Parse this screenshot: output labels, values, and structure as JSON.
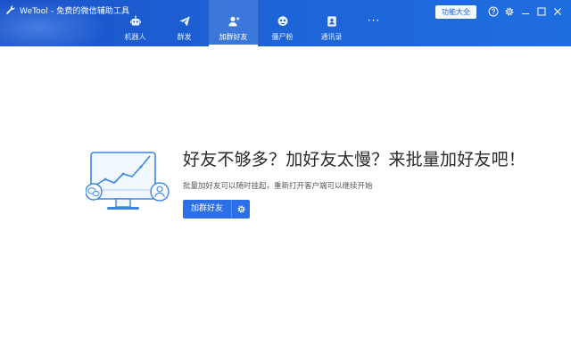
{
  "app": {
    "title": "WeTool - 免费的微信辅助工具",
    "logo_icon": "wrench-icon"
  },
  "tabs": [
    {
      "label": "机器人",
      "icon": "robot-icon",
      "active": false
    },
    {
      "label": "群发",
      "icon": "paper-plane-icon",
      "active": false
    },
    {
      "label": "加群好友",
      "icon": "add-user-icon",
      "active": true
    },
    {
      "label": "僵尸粉",
      "icon": "zombie-face-icon",
      "active": false
    },
    {
      "label": "通讯录",
      "icon": "contacts-book-icon",
      "active": false
    }
  ],
  "more_tab": {
    "label": "···",
    "icon": "more-dots-icon"
  },
  "toolbar": {
    "function_button_label": "功能大全",
    "help_icon": "help-icon",
    "settings_icon": "gear-icon",
    "minimize_icon": "minimize-icon",
    "maximize_icon": "maximize-icon",
    "close_icon": "close-icon"
  },
  "main": {
    "headline": "好友不够多？加好友太慢？来批量加好友吧！",
    "subtext": "批量加好友可以随时挂起，重新打开客户端可以继续开始",
    "primary_button_label": "加群好友",
    "settings_button_icon": "gear-icon"
  },
  "colors": {
    "header_blue": "#1d63d6",
    "accent_blue": "#2d6fe6",
    "illustration_blue": "#3a86e6"
  }
}
